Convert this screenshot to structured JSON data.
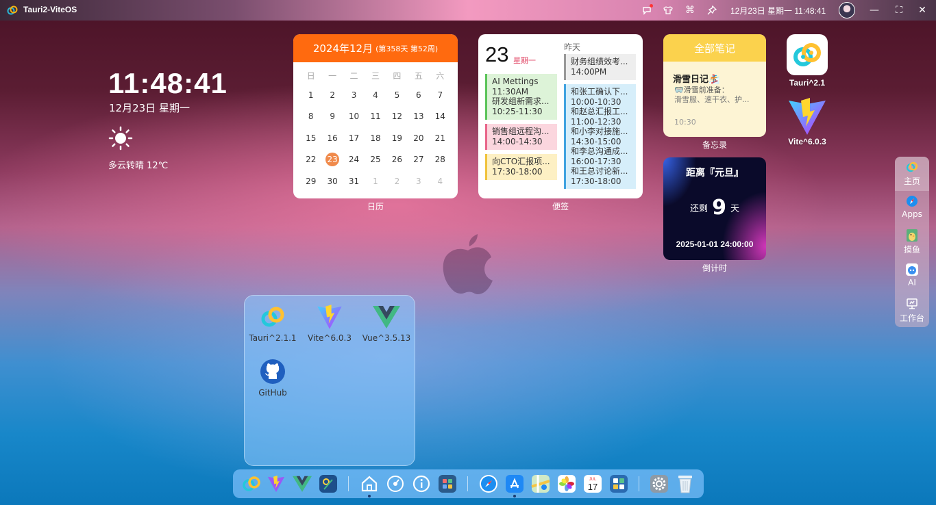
{
  "topbar": {
    "app_title": "Tauri2-ViteOS",
    "datetime": "12月23日 星期一 11:48:41",
    "icons": [
      "chat-icon",
      "shirt-icon",
      "command-icon",
      "pin-icon"
    ],
    "window_controls": [
      "minimize",
      "maximize",
      "close"
    ]
  },
  "clock_widget": {
    "time": "11:48:41",
    "date": "12月23日 星期一",
    "weather": "多云转晴 12℃"
  },
  "calendar": {
    "title": "2024年12月",
    "subtitle": "(第358天 第52周)",
    "weekdays": [
      "日",
      "一",
      "二",
      "三",
      "四",
      "五",
      "六"
    ],
    "days": [
      "1",
      "2",
      "3",
      "4",
      "5",
      "6",
      "7",
      "8",
      "9",
      "10",
      "11",
      "12",
      "13",
      "14",
      "15",
      "16",
      "17",
      "18",
      "19",
      "20",
      "21",
      "22",
      "23",
      "24",
      "25",
      "26",
      "27",
      "28",
      "29",
      "30",
      "31",
      "1",
      "2",
      "3",
      "4"
    ],
    "today": "23",
    "label": "日历"
  },
  "notes": {
    "day": "23",
    "weekday": "星期一",
    "yesterday_label": "昨天",
    "today_events": [
      {
        "lines": [
          "AI Mettings",
          "11:30AM",
          "研发组新需求...",
          "10:25-11:30"
        ]
      },
      {
        "lines": [
          "销售组远程沟...",
          "14:00-14:30"
        ]
      },
      {
        "lines": [
          "向CTO汇报项...",
          "17:30-18:00"
        ]
      }
    ],
    "yesterday_events": [
      {
        "lines": [
          "财务组绩效考...",
          "14:00PM"
        ]
      },
      {
        "lines": [
          "和张工确认下...",
          "10:00-10:30",
          "和赵总汇报工...",
          "11:00-12:30",
          "和小李对接施...",
          "14:30-15:00",
          "和李总沟通成...",
          "16:00-17:30",
          "和王总讨论新...",
          "17:30-18:00"
        ]
      }
    ],
    "label": "便签"
  },
  "memo": {
    "header": "全部笔记",
    "title": "滑雪日记🏂",
    "line1": "🥽滑雪前准备：",
    "line2": "滑雪服、速干衣、护...",
    "time": "10:30",
    "label": "备忘录"
  },
  "countdown": {
    "title": "距离『元旦』",
    "prefix": "还剩",
    "days": "9",
    "suffix": "天",
    "target": "2025-01-01 24:00:00",
    "label": "倒计时"
  },
  "desktop_apps": [
    {
      "label": "Tauri^2.1",
      "icon": "tauri-icon"
    },
    {
      "label": "Vite^6.0.3",
      "icon": "vite-icon"
    }
  ],
  "side_nav": [
    {
      "label": "主页",
      "icon": "home-logo-icon"
    },
    {
      "label": "Apps",
      "icon": "safari-icon"
    },
    {
      "label": "摸鱼",
      "icon": "duck-icon"
    },
    {
      "label": "AI",
      "icon": "ai-bot-icon"
    },
    {
      "label": "工作台",
      "icon": "workbench-icon"
    }
  ],
  "folder_apps": [
    {
      "label": "Tauri^2.1.1",
      "icon": "tauri-icon"
    },
    {
      "label": "Vite^6.0.3",
      "icon": "vite-icon"
    },
    {
      "label": "Vue^3.5.13",
      "icon": "vue-icon"
    },
    {
      "label": "GitHub",
      "icon": "github-icon"
    }
  ],
  "dock": {
    "items": [
      "tauri-icon",
      "vite-icon",
      "vue-icon",
      "maps-icon",
      "home-icon",
      "dashboard-icon",
      "info-icon",
      "app-grid-icon",
      "safari-icon",
      "app-store-icon",
      "maps-app-icon",
      "photos-icon",
      "calendar-icon",
      "reminders-icon",
      "settings-icon",
      "trash-icon"
    ],
    "calendar_icon_month": "JUL",
    "calendar_icon_day": "17"
  },
  "colors": {
    "calendar_header": "#ff6a0f",
    "today_marker": "#f08a4b",
    "memo_header": "#fbd24d"
  }
}
